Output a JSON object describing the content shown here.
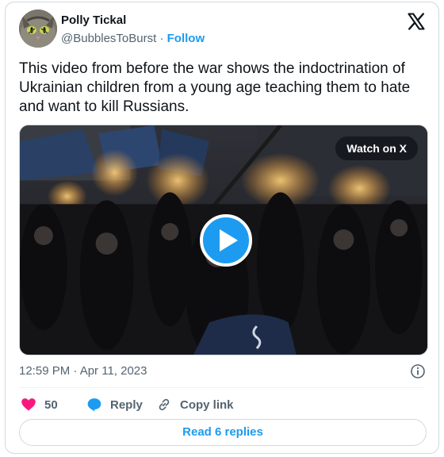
{
  "author": {
    "display_name": "Polly Tickal",
    "handle": "@BubblesToBurst",
    "separator": "·",
    "follow_label": "Follow"
  },
  "tweet": {
    "text": "This video from before the war shows the indoctrination of Ukrainian children from a young age teaching them to hate and want to kill Russians.",
    "timestamp": "12:59 PM · Apr 11, 2023"
  },
  "media": {
    "watch_label": "Watch on X"
  },
  "actions": {
    "like_count": "50",
    "reply_label": "Reply",
    "copy_link_label": "Copy link"
  },
  "footer": {
    "read_replies_label": "Read 6 replies"
  },
  "colors": {
    "accent": "#1d9bf0",
    "like": "#f91880",
    "text_secondary": "#536471"
  }
}
